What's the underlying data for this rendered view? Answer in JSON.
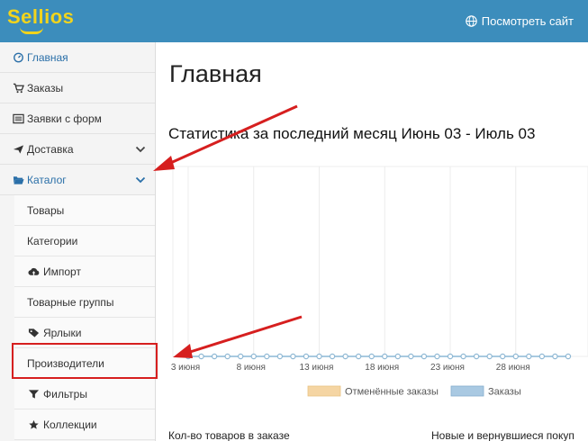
{
  "header": {
    "logo_text": "Sellios",
    "view_site_label": "Посмотреть сайт"
  },
  "sidebar": {
    "items": [
      {
        "label": "Главная",
        "icon": "dashboard-icon",
        "state": "active"
      },
      {
        "label": "Заказы",
        "icon": "cart-icon"
      },
      {
        "label": "Заявки с форм",
        "icon": "list-icon"
      },
      {
        "label": "Доставка",
        "icon": "paper-plane-icon",
        "expandable": true
      },
      {
        "label": "Каталог",
        "icon": "folder-open-icon",
        "expandable": true,
        "expanded": true
      }
    ],
    "catalog_children": [
      {
        "label": "Товары",
        "icon": ""
      },
      {
        "label": "Категории",
        "icon": ""
      },
      {
        "label": "Импорт",
        "icon": "cloud-upload-icon"
      },
      {
        "label": "Товарные группы",
        "icon": ""
      },
      {
        "label": "Ярлыки",
        "icon": "tag-icon"
      },
      {
        "label": "Производители",
        "icon": "",
        "highlighted": true
      },
      {
        "label": "Фильтры",
        "icon": "filter-icon"
      },
      {
        "label": "Коллекции",
        "icon": "star-icon"
      }
    ]
  },
  "main": {
    "page_title": "Главная",
    "stats_title": "Статистика за последний месяц Июнь 03 - Июль 03",
    "bottom_left": "Кол-во товаров в заказе",
    "bottom_right": "Новые и вернувшиеся покуп"
  },
  "colors": {
    "topbar": "#3c8dbc",
    "logo": "#f2d41c",
    "link": "#2a6fa8",
    "annotation": "#d61f1f",
    "cancelled_series": "#f5d5a3",
    "orders_series": "#a9c9e2"
  },
  "chart_data": {
    "type": "line",
    "x": [
      "3 июня",
      "8 июня",
      "13 июня",
      "18 июня",
      "23 июня",
      "28 июня"
    ],
    "series": [
      {
        "name": "Отменённые заказы",
        "values": [
          0,
          0,
          0,
          0,
          0,
          0,
          0,
          0,
          0,
          0,
          0,
          0,
          0,
          0,
          0,
          0,
          0,
          0,
          0,
          0,
          0,
          0,
          0,
          0,
          0,
          0,
          0,
          0,
          0,
          0
        ]
      },
      {
        "name": "Заказы",
        "values": [
          0,
          0,
          0,
          0,
          0,
          0,
          0,
          0,
          0,
          0,
          0,
          0,
          0,
          0,
          0,
          0,
          0,
          0,
          0,
          0,
          0,
          0,
          0,
          0,
          0,
          0,
          0,
          0,
          0,
          0
        ]
      }
    ],
    "legend": "bottom-center",
    "grid": true
  }
}
